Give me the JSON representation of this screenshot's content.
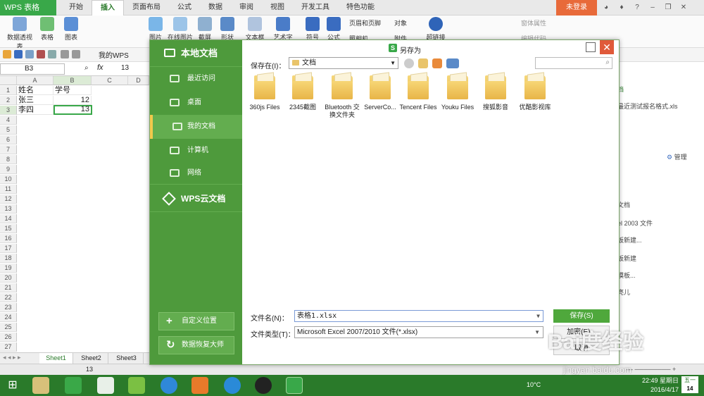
{
  "app": {
    "name": "WPS 表格",
    "login": "未登录"
  },
  "tabs": [
    "开始",
    "插入",
    "页面布局",
    "公式",
    "数据",
    "审阅",
    "视图",
    "开发工具",
    "特色功能"
  ],
  "active_tab": "插入",
  "ribbon": {
    "items": [
      "数据透视表",
      "表格",
      "图表",
      "图片",
      "在线图片",
      "截屏",
      "形状",
      "文本框",
      "艺术字",
      "符号",
      "公式",
      "页眉和页脚",
      "对象",
      "照相机",
      "附件",
      "超链接",
      "窗体属性",
      "编辑代码"
    ]
  },
  "quickbar": {
    "my_wps": "我的WPS"
  },
  "formula_bar": {
    "cell_ref": "B3",
    "fx": "fx",
    "value": "13"
  },
  "sheet": {
    "columns": [
      "A",
      "B",
      "C",
      "D"
    ],
    "rows": [
      "1",
      "2",
      "3",
      "4",
      "5",
      "6",
      "7",
      "8",
      "9",
      "10",
      "11",
      "12",
      "13",
      "14",
      "15",
      "16",
      "17",
      "18",
      "19",
      "20",
      "21",
      "22",
      "23",
      "24",
      "25",
      "26",
      "27"
    ],
    "cells": {
      "A1": "姓名",
      "B1": "学号",
      "A2": "张三",
      "B2": "12",
      "A3": "李四",
      "B3": "13"
    },
    "sheet_tabs": [
      "Sheet1",
      "Sheet2",
      "Sheet3"
    ],
    "active_sheet": "Sheet1"
  },
  "status": {
    "value": "13"
  },
  "right_pane": {
    "items": [
      "档",
      "最近测试报名格式.xls",
      "管理",
      "文档",
      "el 2003 文件",
      "板新建...",
      "板新建",
      "模板...",
      "亮儿"
    ]
  },
  "dialog": {
    "title": "另存为",
    "side_header": "本地文档",
    "side_items": [
      "最近访问",
      "桌面",
      "我的文档",
      "计算机",
      "网络"
    ],
    "side_active": "我的文档",
    "cloud_header": "WPS云文档",
    "custom_location": "自定义位置",
    "recovery": "数据恢复大师",
    "save_in_label": "保存在(I)：",
    "save_in_value": "文档",
    "files": [
      "360js Files",
      "2345截图",
      "Bluetooth 交换文件夹",
      "ServerCo...",
      "Tencent Files",
      "Youku Files",
      "搜狐影音",
      "优酷影视库"
    ],
    "filename_label": "文件名(N)：",
    "filename_value": "表格1.xlsx",
    "filetype_label": "文件类型(T)：",
    "filetype_value": "Microsoft Excel 2007/2010 文件(*.xlsx)",
    "save_btn": "保存(S)",
    "encrypt_btn": "加密(E)...",
    "cancel_btn": "取消"
  },
  "taskbar": {
    "temp": "10°C",
    "time": "22:49 星期日",
    "date": "2016/4/17",
    "ime_top": "五一",
    "ime_bottom": "14"
  },
  "watermark": {
    "logo": "Bai度经验",
    "url": "jingyan.baidu.com"
  }
}
